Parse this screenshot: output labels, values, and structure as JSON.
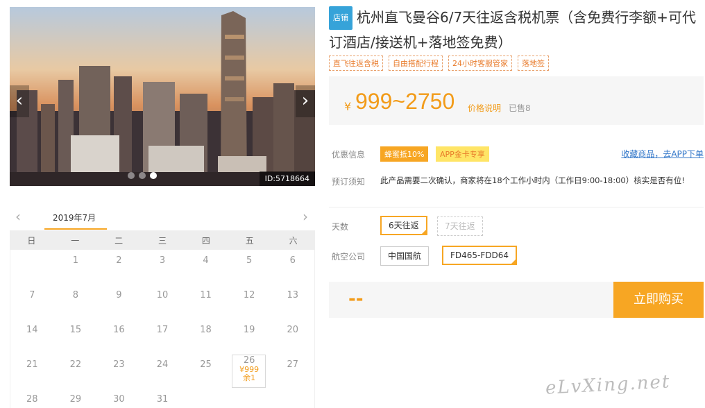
{
  "photo": {
    "image_id": "ID:5718664",
    "prev_icon": "chevron-left-icon",
    "next_icon": "chevron-right-icon"
  },
  "calendar": {
    "month_label": "2019年7月",
    "weekdays": [
      "日",
      "一",
      "二",
      "三",
      "四",
      "五",
      "六"
    ],
    "days": [
      {
        "d": ""
      },
      {
        "d": "1"
      },
      {
        "d": "2"
      },
      {
        "d": "3"
      },
      {
        "d": "4"
      },
      {
        "d": "5"
      },
      {
        "d": "6"
      },
      {
        "d": "7"
      },
      {
        "d": "8"
      },
      {
        "d": "9"
      },
      {
        "d": "10"
      },
      {
        "d": "11"
      },
      {
        "d": "12"
      },
      {
        "d": "13"
      },
      {
        "d": "14"
      },
      {
        "d": "15"
      },
      {
        "d": "16"
      },
      {
        "d": "17"
      },
      {
        "d": "18"
      },
      {
        "d": "19"
      },
      {
        "d": "20"
      },
      {
        "d": "21"
      },
      {
        "d": "22"
      },
      {
        "d": "23"
      },
      {
        "d": "24"
      },
      {
        "d": "25"
      },
      {
        "d": "26",
        "price": "¥999",
        "left": "余1"
      },
      {
        "d": "27"
      },
      {
        "d": "28"
      },
      {
        "d": "29"
      },
      {
        "d": "30"
      },
      {
        "d": "31"
      },
      {
        "d": ""
      },
      {
        "d": ""
      },
      {
        "d": ""
      }
    ]
  },
  "product": {
    "shop_tag": "店铺",
    "title": "杭州直飞曼谷6/7天往返含税机票（含免费行李额+可代订酒店/接送机+落地签免费）",
    "tags": [
      "直飞往返含税",
      "自由搭配行程",
      "24小时客服管家",
      "落地签"
    ]
  },
  "price": {
    "symbol": "¥",
    "range": "999~2750",
    "explain_link": "价格说明",
    "sold": "已售8"
  },
  "promo": {
    "label": "优惠信息",
    "badge_a": "蜂蜜抵10%",
    "badge_b": "APP金卡专享",
    "fav_link": "收藏商品，去APP下单"
  },
  "notice": {
    "label": "预订须知",
    "text": "此产品需要二次确认，商家将在18个工作小时内（工作日9:00-18:00）核实是否有位!"
  },
  "options": {
    "days_label": "天数",
    "days": [
      "6天往返",
      "7天往返"
    ],
    "airline_label": "航空公司",
    "airline": "中国国航",
    "flight": "FD465-FDD64"
  },
  "buy": {
    "total": "--",
    "button": "立即购买"
  },
  "watermark": "eLvXing.net"
}
